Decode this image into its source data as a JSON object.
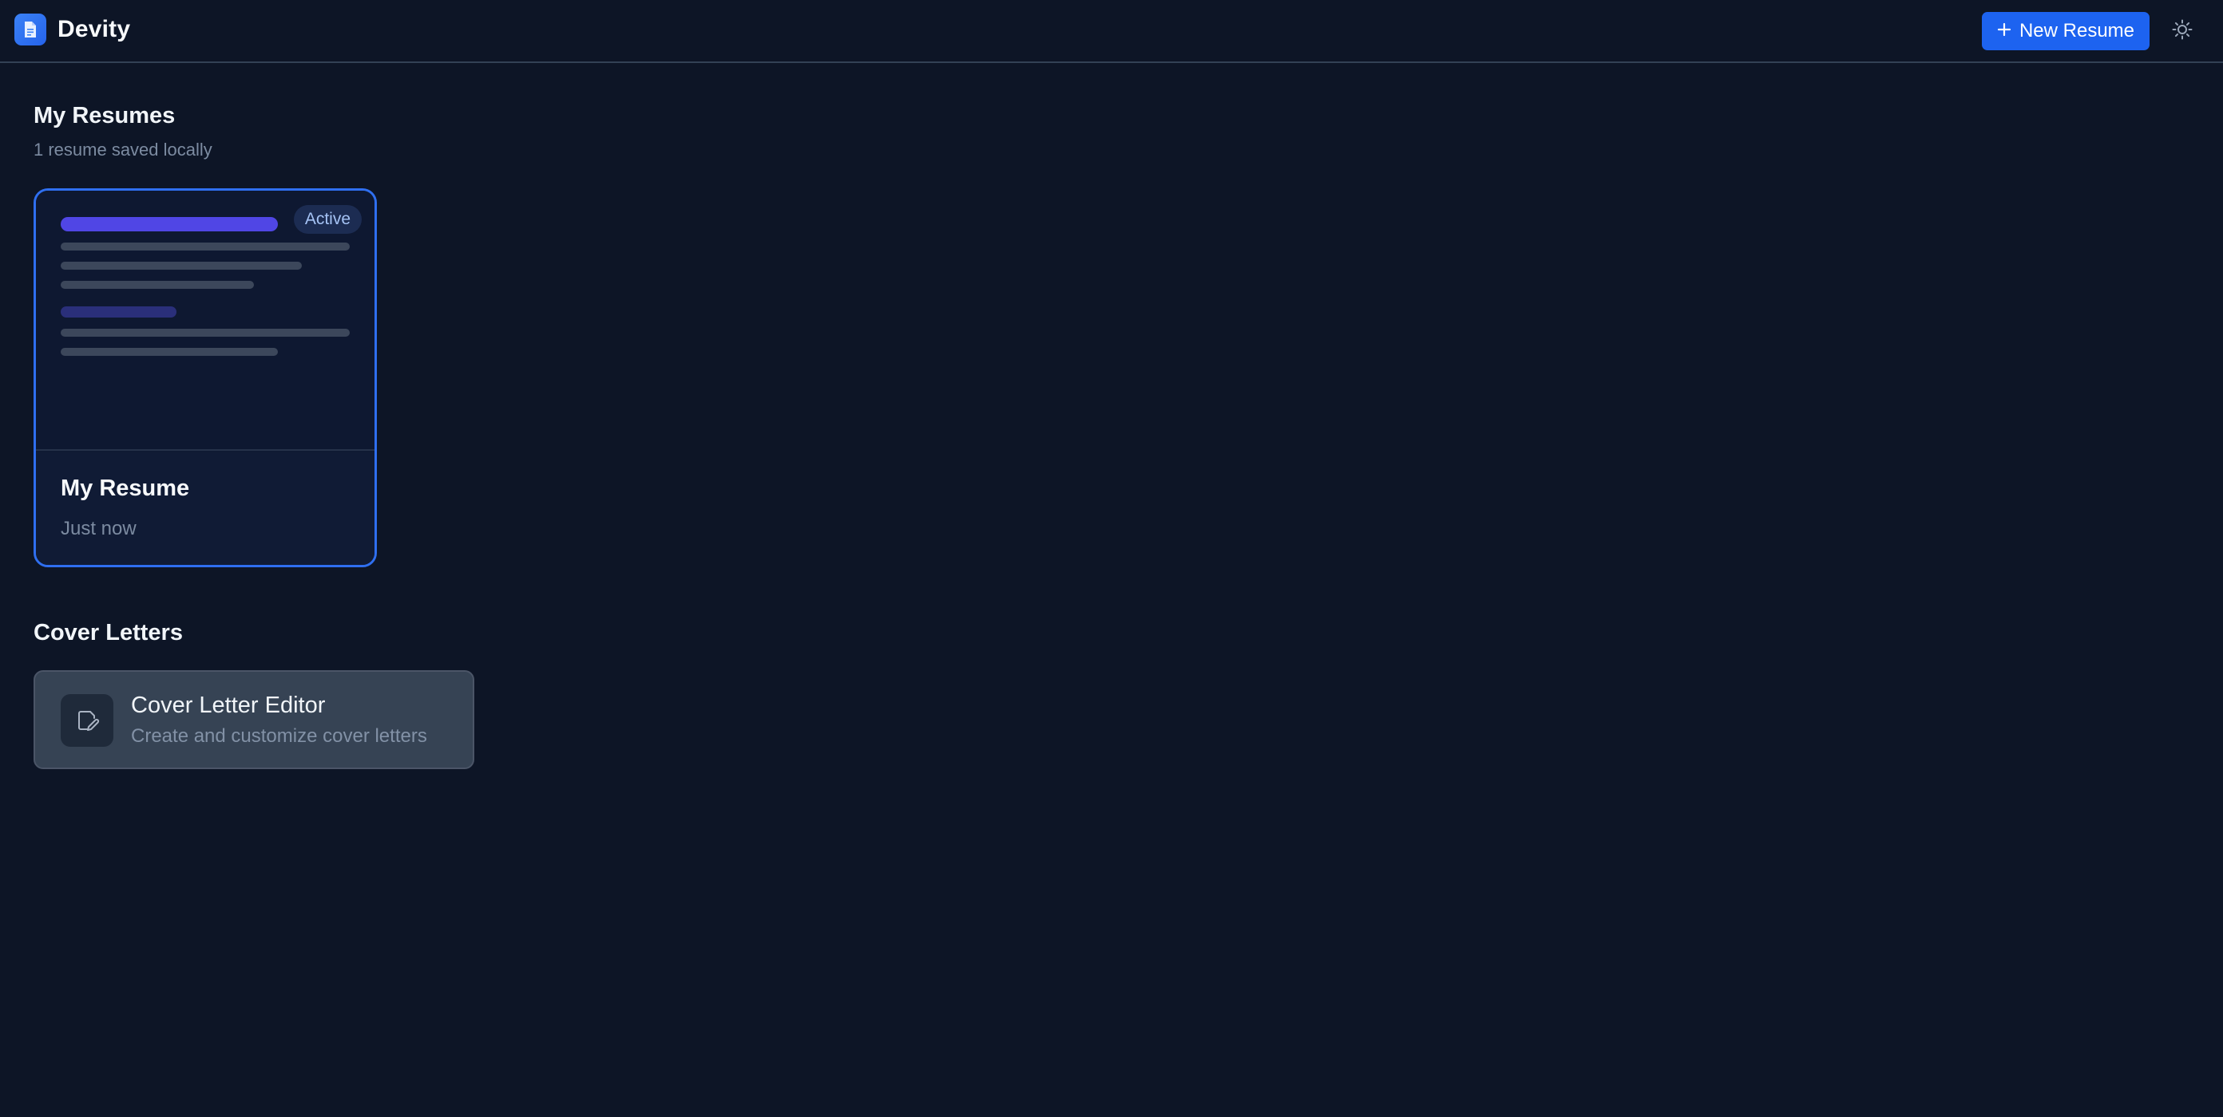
{
  "app": {
    "name": "Devity",
    "logo_icon": "document-icon"
  },
  "header": {
    "new_resume_label": "New Resume",
    "new_resume_icon": "plus-icon",
    "theme_toggle_icon": "sun-icon"
  },
  "resumes_section": {
    "title": "My Resumes",
    "subtitle": "1 resume saved locally",
    "items": [
      {
        "name": "My Resume",
        "updated": "Just now",
        "badge": "Active"
      }
    ]
  },
  "cover_letters_section": {
    "title": "Cover Letters",
    "items": [
      {
        "title": "Cover Letter Editor",
        "description": "Create and customize cover letters",
        "icon": "edit-document-icon"
      }
    ]
  },
  "colors": {
    "background": "#0d1526",
    "accent": "#1d63f0",
    "active_border": "#2f6ff0",
    "preview_title_bar": "#5046e5"
  }
}
